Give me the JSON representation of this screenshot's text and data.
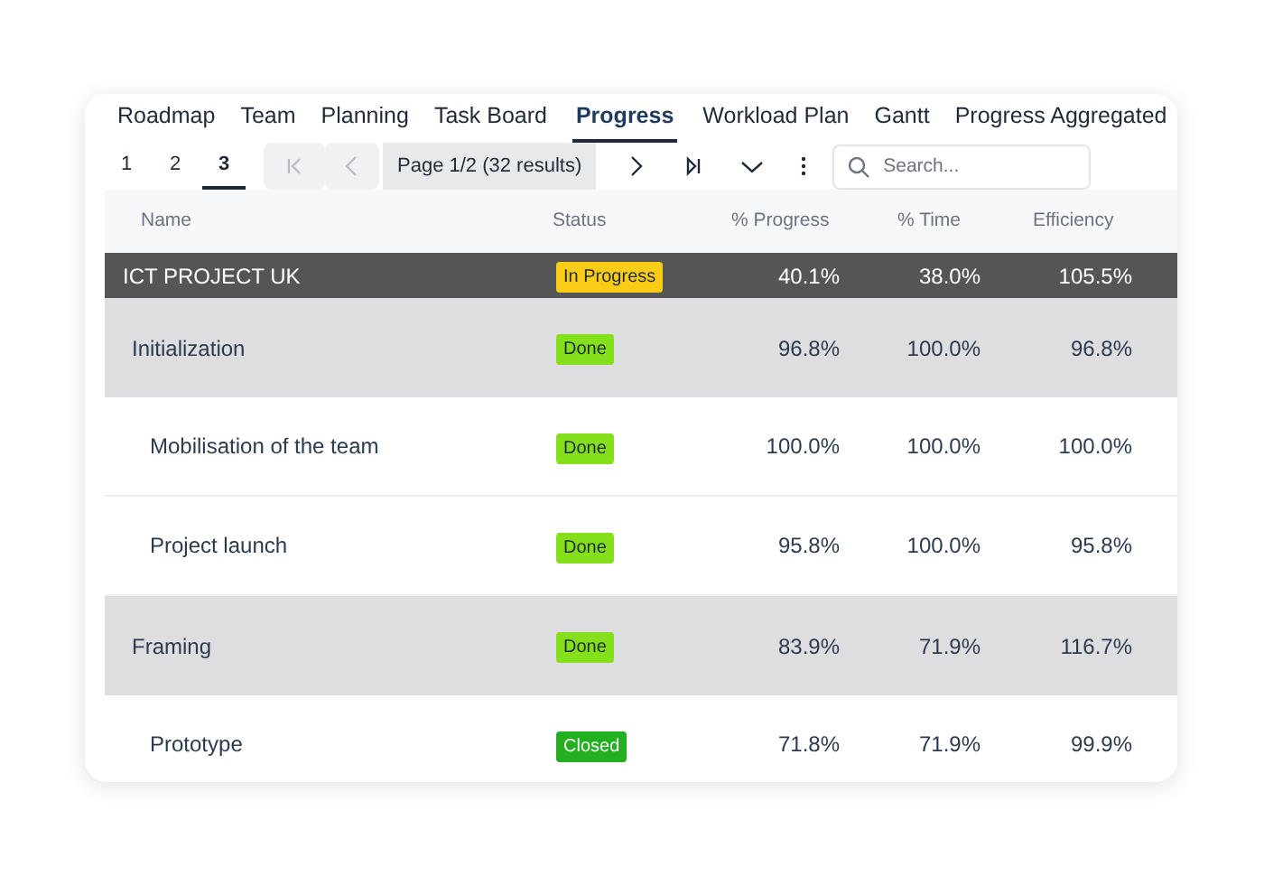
{
  "tabs": [
    {
      "label": "Roadmap",
      "selected": false
    },
    {
      "label": "Team",
      "selected": false
    },
    {
      "label": "Planning",
      "selected": false
    },
    {
      "label": "Task Board",
      "selected": false
    },
    {
      "label": "Progress",
      "selected": true
    },
    {
      "label": "Workload Plan",
      "selected": false
    },
    {
      "label": "Gantt",
      "selected": false
    },
    {
      "label": "Progress Aggregated",
      "selected": false
    }
  ],
  "levels": [
    {
      "label": "1",
      "selected": false
    },
    {
      "label": "2",
      "selected": false
    },
    {
      "label": "3",
      "selected": true
    }
  ],
  "pager": {
    "page_info": "Page 1/2 (32 results)",
    "first_disabled": true,
    "prev_disabled": true
  },
  "search": {
    "placeholder": "Search..."
  },
  "table": {
    "columns": [
      "Name",
      "Status",
      "% Progress",
      "% Time",
      "Efficiency"
    ],
    "rows": [
      {
        "kind": "project",
        "name": "ICT PROJECT UK",
        "status": "In Progress",
        "color": "#facc15",
        "progress": "40.1%",
        "time": "38.0%",
        "efficiency": "105.5%",
        "children": [
          {
            "kind": "phase",
            "name": "Initialization",
            "status": "Done",
            "color": "#84e01a",
            "progress": "96.8%",
            "time": "100.0%",
            "efficiency": "96.8%",
            "children": [
              {
                "kind": "task",
                "name": "Mobilisation of the team",
                "status": "Done",
                "color": "#84e01a",
                "progress": "100.0%",
                "time": "100.0%",
                "efficiency": "100.0%"
              },
              {
                "kind": "task",
                "name": "Project launch",
                "status": "Done",
                "color": "#84e01a",
                "progress": "95.8%",
                "time": "100.0%",
                "efficiency": "95.8%"
              }
            ]
          },
          {
            "kind": "phase",
            "name": "Framing",
            "status": "Done",
            "color": "#84e01a",
            "progress": "83.9%",
            "time": "71.9%",
            "efficiency": "116.7%",
            "children": [
              {
                "kind": "task",
                "name": "Prototype",
                "status": "Closed",
                "color": "#22b020",
                "progress": "71.8%",
                "time": "71.9%",
                "efficiency": "99.9%"
              }
            ]
          }
        ]
      }
    ]
  }
}
